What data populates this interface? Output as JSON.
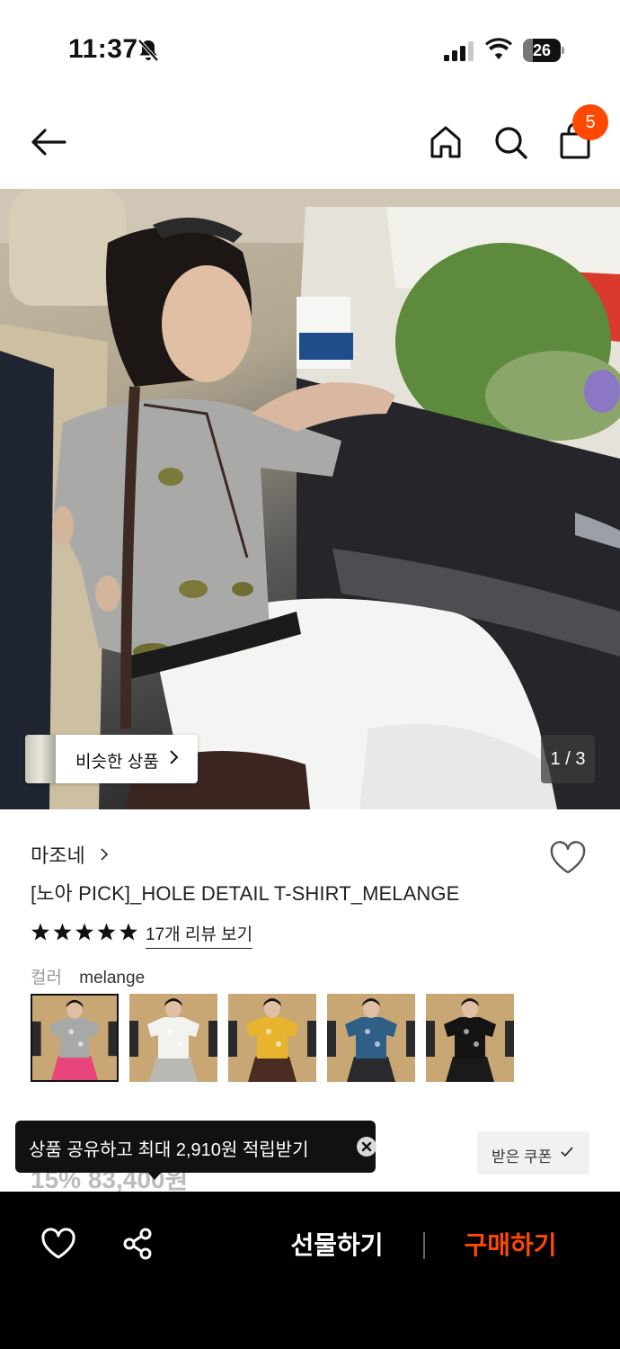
{
  "status": {
    "time": "11:37",
    "battery": "26",
    "battery_level": 0.26
  },
  "nav": {
    "cart_count": "5"
  },
  "image": {
    "similar_label": "비슷한 상품",
    "counter": "1 / 3"
  },
  "product": {
    "brand": "마조네",
    "title": "[노아 PICK]_HOLE DETAIL T-SHIRT_MELANGE",
    "rating": 5,
    "review_link": "17개 리뷰 보기",
    "color_label": "컬러",
    "color_value": "melange",
    "swatches": [
      {
        "shirt": "#a7a9a8",
        "bottom": "#e8457d",
        "selected": true
      },
      {
        "shirt": "#f2f2ee",
        "bottom": "#b9b9b4",
        "selected": false
      },
      {
        "shirt": "#e7b52d",
        "bottom": "#4a2c22",
        "selected": false
      },
      {
        "shirt": "#2f5f86",
        "bottom": "#2a2a2e",
        "selected": false
      },
      {
        "shirt": "#141414",
        "bottom": "#1a1a1a",
        "selected": false
      }
    ]
  },
  "toast": {
    "text": "상품 공유하고 최대 2,910원 적립받기"
  },
  "price_peek": "15% 83,400원",
  "coupon": {
    "label": "받은 쿠폰"
  },
  "bottom": {
    "gift_label": "선물하기",
    "buy_label": "구매하기"
  },
  "colors": {
    "accent": "#ff4800",
    "dark": "#000000",
    "toast_bg": "#111111"
  },
  "icons": [
    "bell-slash-icon",
    "signal-icon",
    "wifi-icon",
    "battery-icon",
    "back-arrow-icon",
    "home-icon",
    "search-icon",
    "shopping-bag-icon",
    "heart-icon",
    "share-icon",
    "close-icon",
    "check-icon",
    "chevron-right-icon"
  ]
}
